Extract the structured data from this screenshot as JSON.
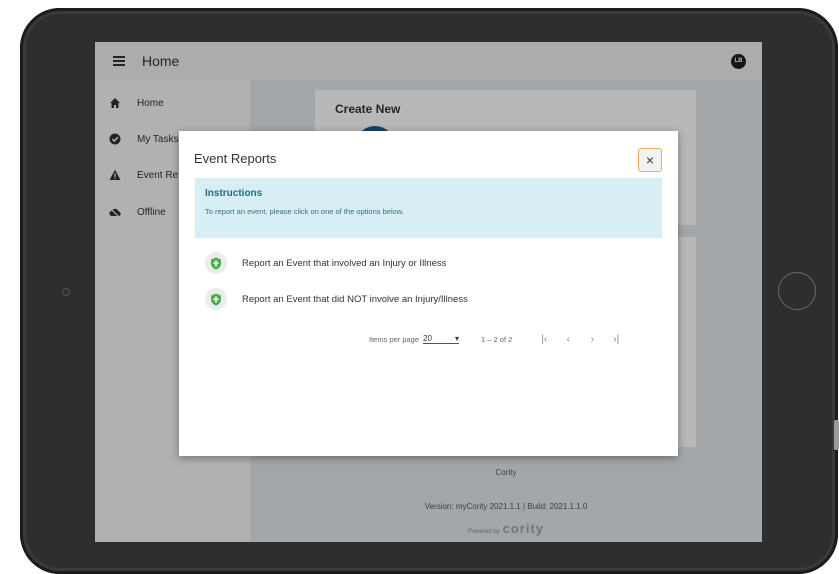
{
  "topbar": {
    "title": "Home",
    "avatar_initials": "LB"
  },
  "sidebar": {
    "items": [
      {
        "label": "Home",
        "icon": "home-icon"
      },
      {
        "label": "My Tasks",
        "icon": "check-circle-icon"
      },
      {
        "label": "Event Re",
        "icon": "warning-icon"
      },
      {
        "label": "Offline",
        "icon": "cloud-off-icon"
      }
    ]
  },
  "main": {
    "create_new": "Create New"
  },
  "footer": {
    "company": "Cority",
    "version": "Version: myCority 2021.1.1 | Build: 2021.1.1.0",
    "powered_by": "Powered by",
    "brand": "cority"
  },
  "modal": {
    "title": "Event Reports",
    "close_label": "×",
    "instructions": {
      "title": "Instructions",
      "text": "To report an event, please click on one of the options below."
    },
    "options": [
      {
        "label": "Report an Event that involved an Injury or Illness",
        "icon": "shield-icon"
      },
      {
        "label": "Report an Event that did NOT involve an Injury/Illness",
        "icon": "shield-icon"
      }
    ],
    "pager": {
      "items_per_page_label": "Items per page",
      "page_size": "20",
      "range": "1 – 2 of 2"
    }
  },
  "colors": {
    "accent_green": "#4caf50",
    "instructions_bg": "#d7eef4",
    "instructions_title": "#2a6a7e"
  }
}
